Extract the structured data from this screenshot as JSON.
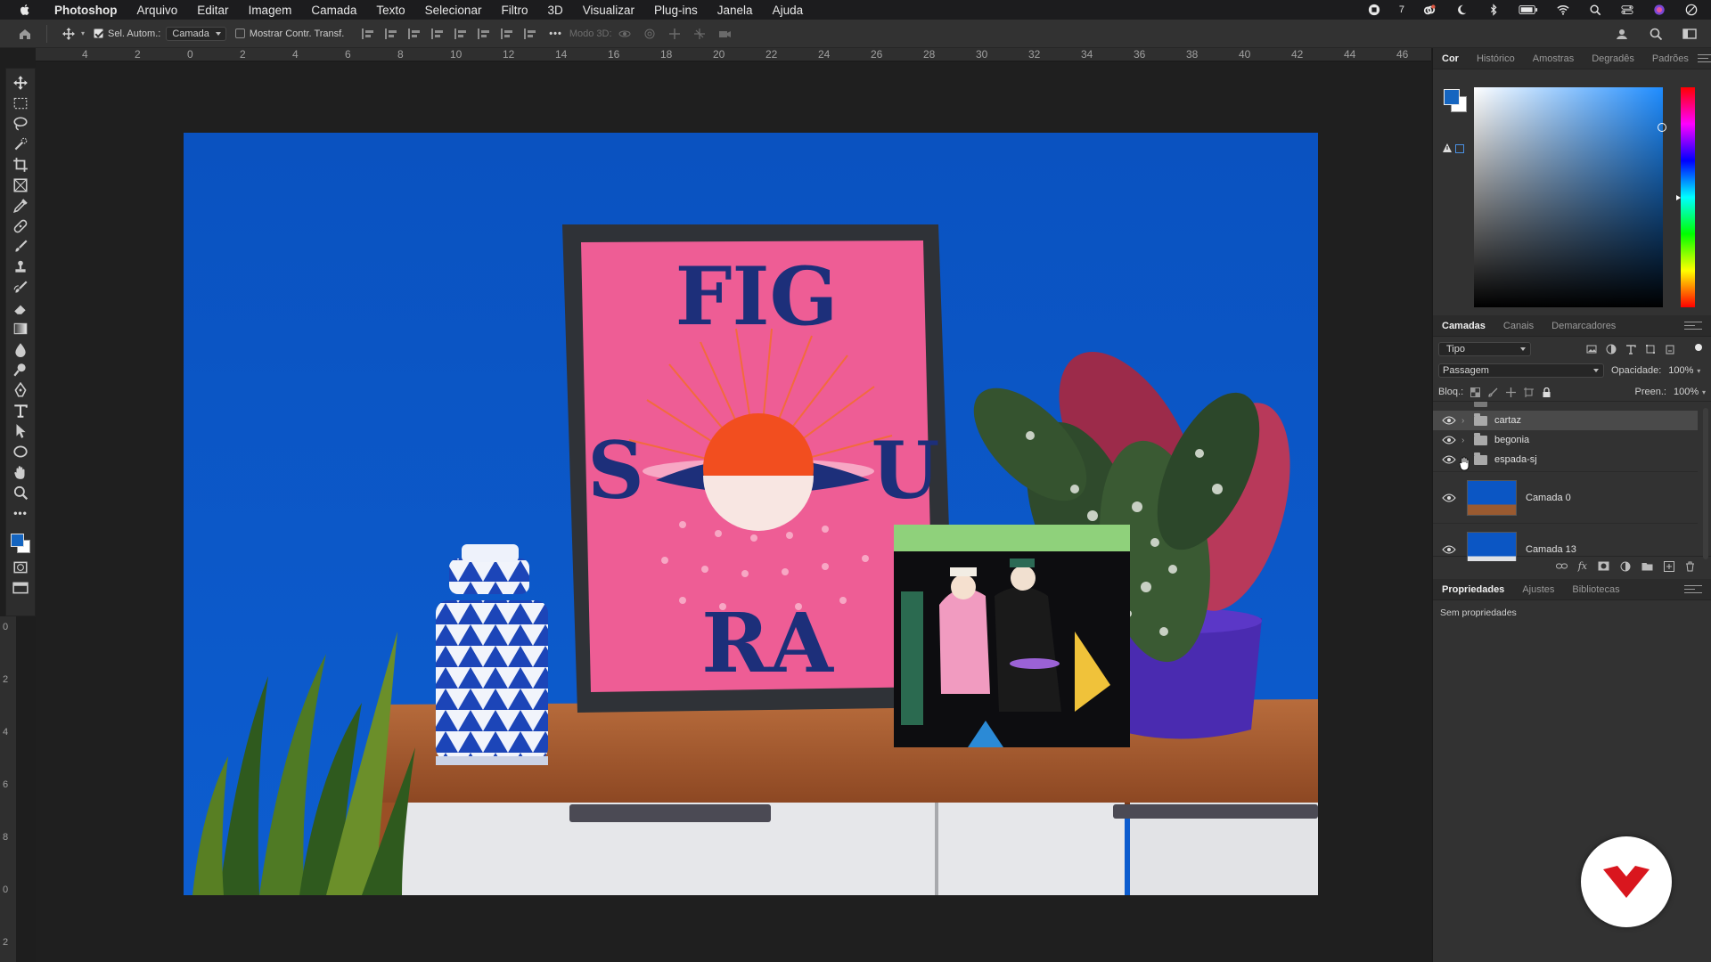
{
  "menubar": {
    "app": "Photoshop",
    "items": [
      "Arquivo",
      "Editar",
      "Imagem",
      "Camada",
      "Texto",
      "Selecionar",
      "Filtro",
      "3D",
      "Visualizar",
      "Plug-ins",
      "Janela",
      "Ajuda"
    ],
    "status_number": "7"
  },
  "options": {
    "auto_select_label": "Sel. Autom.:",
    "auto_select_target": "Camada",
    "show_transform_label": "Mostrar Contr. Transf.",
    "mode_3d_label": "Modo 3D:"
  },
  "rulers": {
    "top": [
      "4",
      "2",
      "0",
      "2",
      "4",
      "6",
      "8",
      "10",
      "12",
      "14",
      "16",
      "18",
      "20",
      "22",
      "24",
      "26",
      "28",
      "30",
      "32",
      "34",
      "36",
      "38",
      "40",
      "42",
      "44",
      "46"
    ],
    "left": [
      "0",
      "2",
      "4",
      "6",
      "8",
      "0",
      "2"
    ]
  },
  "tools": [
    "move-tool",
    "marquee-tool",
    "lasso-tool",
    "quick-select-tool",
    "crop-tool",
    "frame-tool",
    "eyedropper-tool",
    "healing-tool",
    "brush-tool",
    "stamp-tool",
    "history-brush-tool",
    "eraser-tool",
    "gradient-tool",
    "blur-tool",
    "dodge-tool",
    "pen-tool",
    "type-tool",
    "path-select-tool",
    "ellipse-tool",
    "hand-tool",
    "zoom-tool",
    "more-tools"
  ],
  "colors": {
    "foreground": "#1565c0",
    "background": "#ffffff",
    "photo_wall": "#0b56c4",
    "poster_pink": "#ee5d95",
    "poster_navy": "#1d2f7a"
  },
  "color_panel": {
    "tabs": [
      "Cor",
      "Histórico",
      "Amostras",
      "Degradês",
      "Padrões"
    ],
    "active": "Cor"
  },
  "layers_panel": {
    "tabs": [
      "Camadas",
      "Canais",
      "Demarcadores"
    ],
    "active": "Camadas",
    "filter": "Tipo",
    "blend_mode": "Passagem",
    "opacity_label": "Opacidade:",
    "opacity_value": "100%",
    "lock_label": "Bloq.:",
    "fill_label": "Preen.:",
    "fill_value": "100%",
    "layers": [
      {
        "name": "cartaz",
        "type": "group",
        "selected": true
      },
      {
        "name": "begonia",
        "type": "group",
        "selected": false
      },
      {
        "name": "espada-sj",
        "type": "group",
        "selected": false
      },
      {
        "name": "Camada 0",
        "type": "pixel",
        "selected": false
      },
      {
        "name": "Camada 13",
        "type": "pixel",
        "selected": false
      }
    ]
  },
  "properties_panel": {
    "tabs": [
      "Propriedades",
      "Ajustes",
      "Bibliotecas"
    ],
    "active": "Propriedades",
    "empty_text": "Sem propriedades"
  },
  "poster": {
    "line1": "FIG",
    "left_letter": "S",
    "right_letter": "U",
    "line3": "RA"
  }
}
